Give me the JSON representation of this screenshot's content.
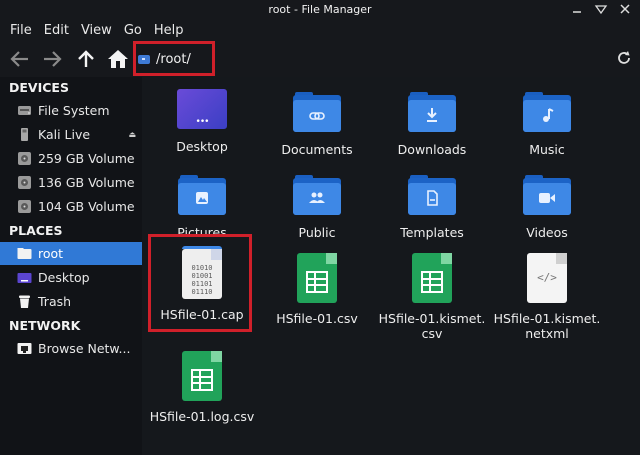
{
  "window": {
    "title": "root - File Manager"
  },
  "menu": [
    "File",
    "Edit",
    "View",
    "Go",
    "Help"
  ],
  "path": {
    "text": "/root/"
  },
  "sidebar": {
    "devices_title": "DEVICES",
    "devices": [
      {
        "label": "File System",
        "icon": "harddisk-icon"
      },
      {
        "label": "Kali Live",
        "icon": "usb-icon"
      },
      {
        "label": "259 GB Volume",
        "icon": "volume-icon"
      },
      {
        "label": "136 GB Volume",
        "icon": "volume-icon"
      },
      {
        "label": "104 GB Volume",
        "icon": "volume-icon"
      }
    ],
    "places_title": "PLACES",
    "places": [
      {
        "label": "root",
        "icon": "folder-icon",
        "active": true
      },
      {
        "label": "Desktop",
        "icon": "desktop-icon"
      },
      {
        "label": "Trash",
        "icon": "trash-icon"
      }
    ],
    "network_title": "NETWORK",
    "network": [
      {
        "label": "Browse Netw...",
        "icon": "network-icon"
      }
    ]
  },
  "files": [
    {
      "name": "Desktop",
      "type": "desktop-folder"
    },
    {
      "name": "Documents",
      "type": "folder",
      "emblem": "link"
    },
    {
      "name": "Downloads",
      "type": "folder",
      "emblem": "download"
    },
    {
      "name": "Music",
      "type": "folder",
      "emblem": "music"
    },
    {
      "name": "Pictures",
      "type": "folder",
      "emblem": "image"
    },
    {
      "name": "Public",
      "type": "folder",
      "emblem": "people"
    },
    {
      "name": "Templates",
      "type": "folder",
      "emblem": "template"
    },
    {
      "name": "Videos",
      "type": "folder",
      "emblem": "video"
    },
    {
      "name": "HSfile-01.cap",
      "type": "binary",
      "binary_text": "01010\n01001\n01101\n01110"
    },
    {
      "name": "HSfile-01.csv",
      "type": "spreadsheet"
    },
    {
      "name": "HSfile-01.kismet.csv",
      "type": "spreadsheet"
    },
    {
      "name": "HSfile-01.kismet.netxml",
      "type": "xml",
      "xml_glyph": "</>"
    },
    {
      "name": "HSfile-01.log.csv",
      "type": "spreadsheet"
    }
  ],
  "colors": {
    "accent": "#3079d6",
    "highlight": "#d0202a",
    "folder": "#3e88e6",
    "sheet_green": "#21a35a"
  }
}
